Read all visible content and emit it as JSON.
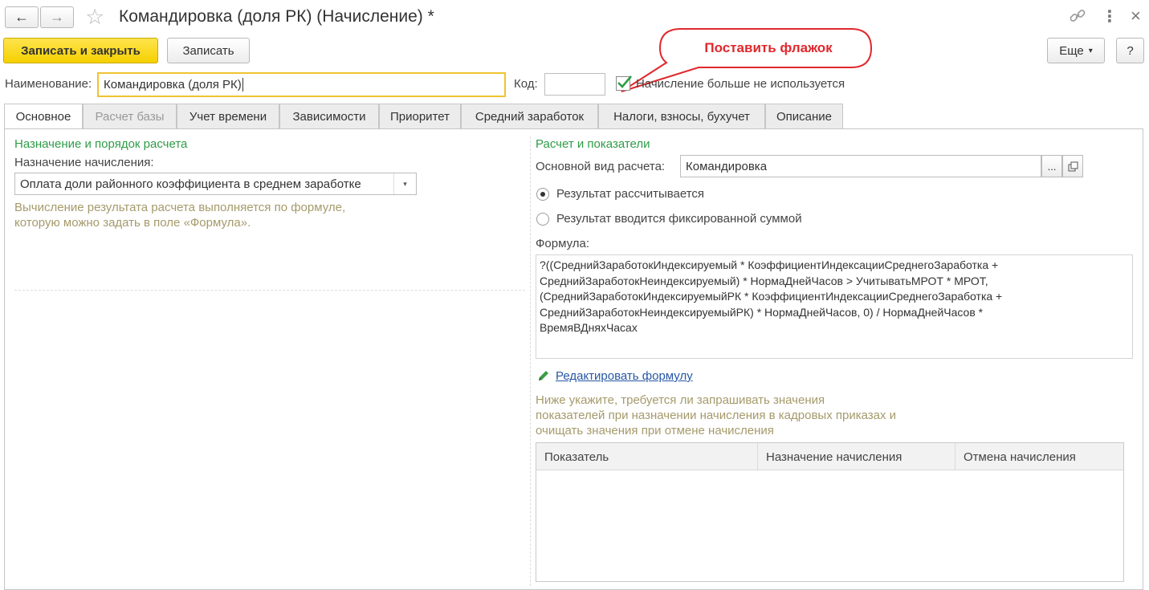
{
  "header": {
    "title": "Командировка (доля РК) (Начисление) *",
    "back_icon": "←",
    "forward_icon": "→",
    "favorite_icon": "☆",
    "link_icon": "🔗",
    "menu_icon": "⋮",
    "close_icon": "×"
  },
  "toolbar": {
    "save_close_label": "Записать и закрыть",
    "save_label": "Записать",
    "more_label": "Еще",
    "more_arrow": "▾",
    "help_label": "?"
  },
  "callout": {
    "text": "Поставить флажок",
    "color": "#e0282d"
  },
  "fields": {
    "name_label": "Наименование:",
    "name_value": "Командировка (доля РК)",
    "code_label": "Код:",
    "code_value": "",
    "unused_checked": true,
    "unused_label": "Начисление больше не используется"
  },
  "tabs": [
    {
      "label": "Основное",
      "state": "active"
    },
    {
      "label": "Расчет базы",
      "state": "disabled"
    },
    {
      "label": "Учет времени",
      "state": "normal"
    },
    {
      "label": "Зависимости",
      "state": "normal"
    },
    {
      "label": "Приоритет",
      "state": "normal"
    },
    {
      "label": "Средний заработок",
      "state": "normal"
    },
    {
      "label": "Налоги, взносы, бухучет",
      "state": "normal"
    },
    {
      "label": "Описание",
      "state": "normal"
    }
  ],
  "left": {
    "section_title": "Назначение и порядок расчета",
    "purpose_label": "Назначение начисления:",
    "purpose_value": "Оплата доли районного коэффициента в среднем заработке",
    "hint_line1": "Вычисление результата расчета выполняется по формуле,",
    "hint_line2": "которую можно задать в поле «Формула»."
  },
  "right": {
    "section_title": "Расчет и показатели",
    "base_type_label": "Основной вид расчета:",
    "base_type_value": "Командировка",
    "dots_label": "...",
    "radio_calculated": "Результат рассчитывается",
    "radio_fixed": "Результат вводится фиксированной суммой",
    "radio_selected": "calculated",
    "formula_label": "Формула:",
    "formula_lines": [
      "?((СреднийЗаработокИндексируемый * КоэффициентИндексацииСреднегоЗаработка +",
      "СреднийЗаработокНеиндексируемый) * НормаДнейЧасов > УчитыватьМРОТ * МРОТ,",
      "(СреднийЗаработокИндексируемыйРК * КоэффициентИндексацииСреднегоЗаработка +",
      "СреднийЗаработокНеиндексируемыйРК) * НормаДнейЧасов, 0) / НормаДнейЧасов *",
      "ВремяВДняхЧасах"
    ],
    "edit_formula_link": "Редактировать формулу",
    "hint_line1": "Ниже укажите, требуется ли запрашивать значения",
    "hint_line2": "показателей при назначении начисления в кадровых приказах и",
    "hint_line3": "очищать значения при отмене начисления",
    "table_headers": [
      "Показатель",
      "Назначение начисления",
      "Отмена начисления"
    ]
  }
}
